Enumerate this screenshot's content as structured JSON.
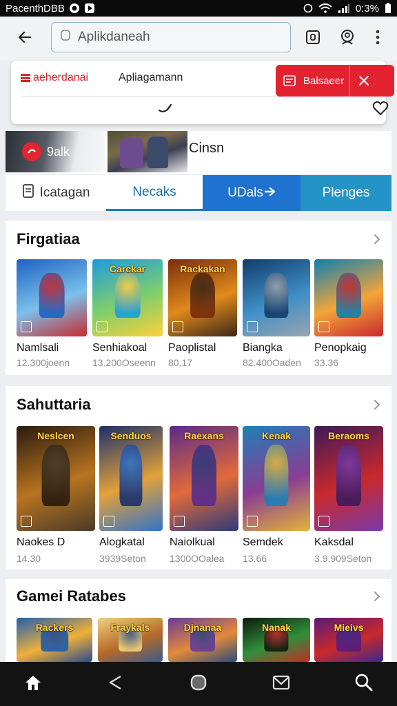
{
  "status_bar": {
    "carrier": "PacenthDBB",
    "battery": "0:3%"
  },
  "search": {
    "value": "Aplikdaneah"
  },
  "suggestion": {
    "brand": "aeherdanai",
    "query": "Apliagamann",
    "cta_label": "Balsaeer"
  },
  "promo": {
    "label": "9alk",
    "title": "Cinsn"
  },
  "tabs": [
    "Icatagan",
    "Necaks",
    "UDals",
    "Plenges"
  ],
  "sections": [
    {
      "title": "Firgatiaa",
      "items": [
        {
          "name": "Namlsali",
          "meta": "12.300joenn",
          "colors": [
            "#1d62c2",
            "#7cc0ea",
            "#c8292c"
          ],
          "logo": ""
        },
        {
          "name": "Senhiakoal",
          "meta": "13.200Oseenn",
          "colors": [
            "#1e9be0",
            "#7fcf6b",
            "#ffcf3b"
          ],
          "logo": "Carckar"
        },
        {
          "name": "Paoplistal",
          "meta": "80.17",
          "colors": [
            "#7a2d0b",
            "#e08a1c",
            "#3b2716"
          ],
          "logo": "Rackakan"
        },
        {
          "name": "Biangka",
          "meta": "82.400Oaden",
          "colors": [
            "#123d6a",
            "#3f8fc7",
            "#9aa4ae"
          ],
          "logo": ""
        },
        {
          "name": "Penopkaig",
          "meta": "33.36",
          "colors": [
            "#0f7fb0",
            "#f2a53a",
            "#c8292c"
          ],
          "logo": ""
        }
      ]
    },
    {
      "title": "Sahuttaria",
      "items": [
        {
          "name": "Naokes D",
          "meta": "14.30",
          "colors": [
            "#2a1a0e",
            "#b87420",
            "#4a3a28"
          ],
          "logo": "Neslcen"
        },
        {
          "name": "Alogkatal",
          "meta": "3939Seton",
          "colors": [
            "#1c2f6b",
            "#e2a13a",
            "#3273c8"
          ],
          "logo": "Senduos"
        },
        {
          "name": "Naiolkual",
          "meta": "1300OOalea",
          "colors": [
            "#5a2a8a",
            "#e26a3a",
            "#2d3a7a"
          ],
          "logo": "Raexans"
        },
        {
          "name": "Semdek",
          "meta": "13.66",
          "colors": [
            "#1f7fb8",
            "#8a3d93",
            "#e2b43a"
          ],
          "logo": "Kenak"
        },
        {
          "name": "Kaksdal",
          "meta": "3.9.909Seton",
          "colors": [
            "#3d1a5a",
            "#c8292c",
            "#7a3aa8"
          ],
          "logo": "Beraoms"
        }
      ]
    },
    {
      "title": "Gamei Ratabes",
      "items": [
        {
          "name": "",
          "meta": "",
          "colors": [
            "#1d5fb0",
            "#f0b03a",
            "#2b4b8a"
          ],
          "logo": "Rackers"
        },
        {
          "name": "",
          "meta": "",
          "colors": [
            "#f0d27a",
            "#b56a2a",
            "#3a5a8a"
          ],
          "logo": "Fraykals"
        },
        {
          "name": "",
          "meta": "",
          "colors": [
            "#6a3a9a",
            "#e28a3a",
            "#2a4a7a"
          ],
          "logo": "Djnanaa"
        },
        {
          "name": "",
          "meta": "",
          "colors": [
            "#0c1a0c",
            "#2f8f3a",
            "#c8292c"
          ],
          "logo": "Nanak"
        },
        {
          "name": "",
          "meta": "",
          "colors": [
            "#5a1a7a",
            "#c8292c",
            "#3a2a8a"
          ],
          "logo": "Mieivs"
        }
      ]
    }
  ],
  "colors": {
    "accent_red": "#e3222f",
    "tab_blue": "#1d73cf",
    "tab_teal": "#2494c7",
    "nav_bg": "#131313"
  },
  "icons": [
    "back-arrow-icon",
    "wallet-icon",
    "account-icon",
    "more-icon",
    "home-icon",
    "back-nav-icon",
    "recents-icon",
    "mail-icon",
    "search-icon"
  ]
}
